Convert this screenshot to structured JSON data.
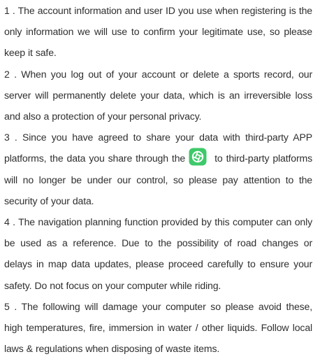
{
  "paragraphs": [
    {
      "text": "1 . The account information and user ID you use when registering is the only information we will use to confirm your legitimate use, so please keep it safe."
    },
    {
      "text": "2 . When you log out of your account or delete a sports record, our server will permanently delete your data, which is an irreversible loss and also a protection of your personal privacy."
    },
    {
      "text_before_icon": "3 . Since you have agreed to share your data with third-party APP platforms, the data you share through the",
      "icon": "share-app-icon",
      "text_after_icon": "to third-party platforms will no longer be under our control, so please pay attention to the security of your data."
    },
    {
      "text": "4 . The navigation planning function provided by this computer can only be used as a reference. Due to the possibility of road changes or delays in map data updates, please proceed carefully to ensure your safety. Do not focus on your computer while riding."
    },
    {
      "text": "5 . The following will damage your computer so please avoid these, high temperatures, fire, immersion in water / other liquids. Follow local laws & regulations when disposing of waste items."
    }
  ],
  "colors": {
    "text": "#2f2f2f",
    "icon_green": "#3ec96a",
    "background": "#ffffff"
  }
}
